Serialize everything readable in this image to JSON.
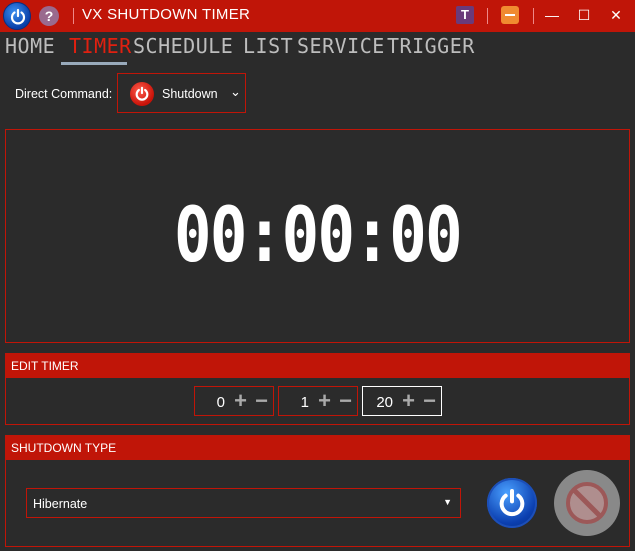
{
  "window": {
    "title": "VX SHUTDOWN TIMER",
    "help_glyph": "?",
    "t_glyph": "T",
    "maximize_glyph": "☐",
    "close_glyph": "✕",
    "minimize_glyph": "—"
  },
  "nav": {
    "tabs": [
      {
        "label": "HOME",
        "active": false
      },
      {
        "label": "TIMER",
        "active": true
      },
      {
        "label": "SCHEDULE",
        "active": false
      },
      {
        "label": "LIST",
        "active": false
      },
      {
        "label": "SERVICE",
        "active": false
      },
      {
        "label": "TRIGGER",
        "active": false
      }
    ]
  },
  "direct_command": {
    "label": "Direct Command:",
    "value": "Shutdown",
    "chevron": "⌄"
  },
  "timer": {
    "display": "00:00:00"
  },
  "edit_timer": {
    "heading": "EDIT TIMER",
    "plus": "+",
    "minus": "−",
    "fields": [
      {
        "value": "0"
      },
      {
        "value": "1"
      },
      {
        "value": "20"
      }
    ]
  },
  "shutdown_type": {
    "heading": "SHUTDOWN TYPE",
    "selected": "Hibernate",
    "arrow": "▼"
  },
  "colors": {
    "accent": "#c01508",
    "background": "#2b2b2b",
    "tab_active": "#e02010",
    "tab_inactive": "#bdbdbd"
  },
  "icons": {
    "app": "power-icon",
    "help": "help-icon",
    "shutdown": "power-icon",
    "start": "power-icon",
    "cancel": "prohibited-icon"
  }
}
